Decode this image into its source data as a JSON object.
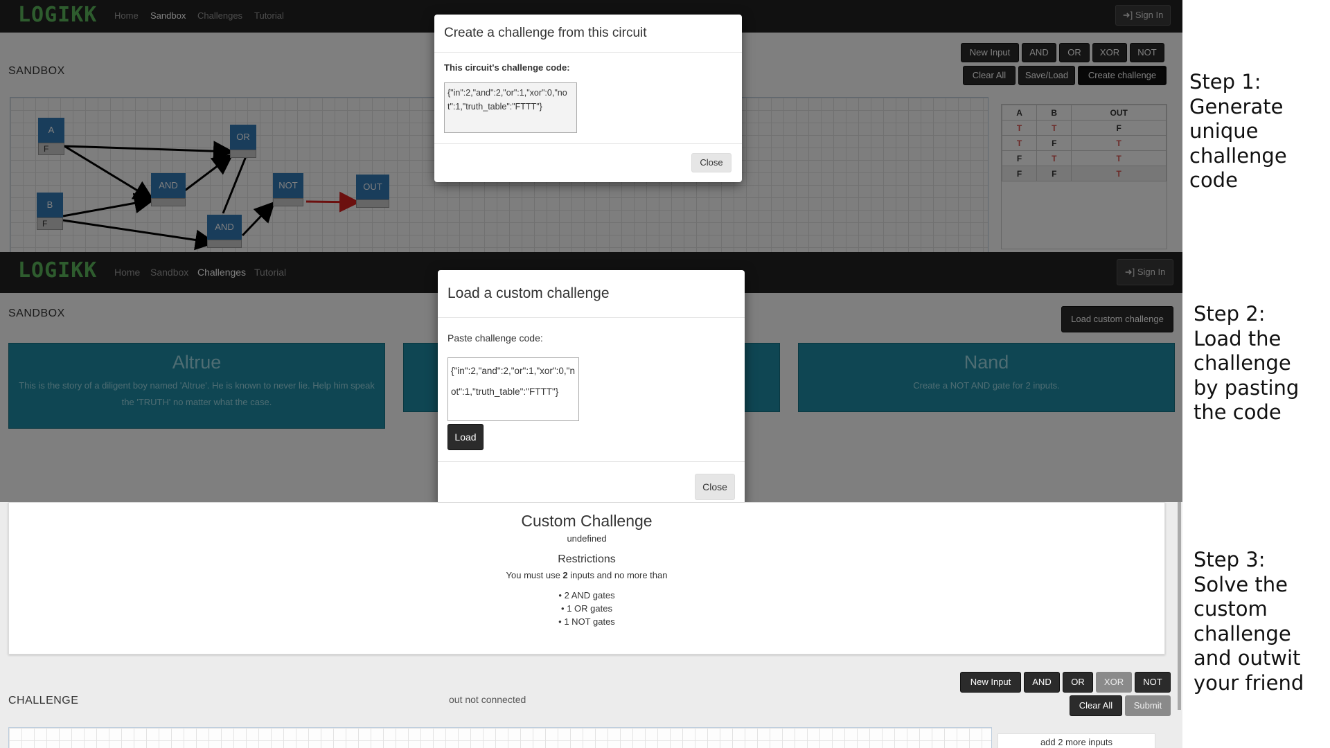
{
  "brand": "LOGIKK",
  "nav": {
    "home": "Home",
    "sandbox": "Sandbox",
    "challenges": "Challenges",
    "tutorial": "Tutorial",
    "signin": "Sign In"
  },
  "panel1": {
    "heading": "SANDBOX",
    "toolbar_row1": [
      "New Input",
      "AND",
      "OR",
      "XOR",
      "NOT"
    ],
    "toolbar_row2": [
      "Clear All",
      "Save/Load",
      "Create challenge"
    ],
    "gates": {
      "a": "A",
      "b": "B",
      "or": "OR",
      "and1": "AND",
      "and2": "AND",
      "not": "NOT",
      "out": "OUT",
      "a_val": "F",
      "b_val": "F"
    },
    "truth_table": {
      "headers": [
        "A",
        "B",
        "OUT"
      ],
      "rows": [
        [
          "T",
          "T",
          "F"
        ],
        [
          "T",
          "F",
          "T"
        ],
        [
          "F",
          "T",
          "T"
        ],
        [
          "F",
          "F",
          "T"
        ]
      ]
    },
    "modal": {
      "title": "Create a challenge from this circuit",
      "label": "This circuit's challenge code:",
      "code": "{\"in\":2,\"and\":2,\"or\":1,\"xor\":0,\"not\":1,\"truth_table\":\"FTTT\"}",
      "close": "Close"
    }
  },
  "panel2": {
    "heading": "SANDBOX",
    "load_button": "Load custom challenge",
    "cards": [
      {
        "title": "Altrue",
        "desc": "This is the story of a diligent boy named 'Altrue'. He is known to never lie. Help him speak the 'TRUTH' no matter what the case."
      },
      {
        "title": "Nand",
        "desc": "Create a NOT AND gate for 2 inputs."
      }
    ],
    "modal": {
      "title": "Load a custom challenge",
      "label": "Paste challenge code:",
      "code": "{\"in\":2,\"and\":2,\"or\":1,\"xor\":0,\"not\":1,\"truth_table\":\"FTTT\"}",
      "load": "Load",
      "close": "Close"
    }
  },
  "panel3": {
    "title": "Custom Challenge",
    "subtitle": "undefined",
    "restrictions_heading": "Restrictions",
    "restriction_prefix": "You must use ",
    "restriction_count": "2",
    "restriction_suffix": " inputs and no more than",
    "limits": [
      "2 AND gates",
      "1 OR gates",
      "1 NOT gates"
    ],
    "heading": "CHALLENGE",
    "status": "out not connected",
    "toolbar_row1": [
      "New Input",
      "AND",
      "OR",
      "XOR",
      "NOT"
    ],
    "toolbar_row2": [
      "Clear All",
      "Submit"
    ],
    "hint": "add 2 more inputs"
  },
  "steps": {
    "step1": [
      "Step 1:",
      "Generate",
      "unique",
      "challenge",
      "code"
    ],
    "step2": [
      "Step 2:",
      "Load the",
      "challenge",
      "by pasting",
      "the code"
    ],
    "step3": [
      "Step 3:",
      "Solve the",
      "custom",
      "challenge",
      "and outwit",
      "your friend"
    ]
  },
  "colors": {
    "gate": "#337ab7",
    "card": "#1f8da6",
    "logo": "#5cb85c",
    "truth_red": "#d9534f",
    "wire_active": "#d9201f"
  }
}
